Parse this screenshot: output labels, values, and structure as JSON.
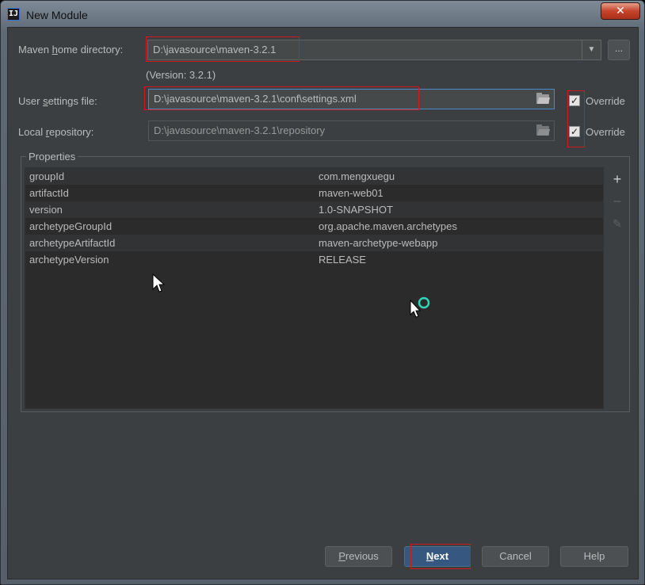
{
  "window": {
    "title": "New Module",
    "app_icon_text": "IJ",
    "close_glyph": "✕"
  },
  "maven": {
    "home_label_pre": "Maven ",
    "home_label_u": "h",
    "home_label_post": "ome directory:",
    "home_value": "D:\\javasource\\maven-3.2.1",
    "version_text": "(Version: 3.2.1)",
    "settings_label_pre": "User ",
    "settings_label_u": "s",
    "settings_label_post": "ettings file:",
    "settings_value": "D:\\javasource\\maven-3.2.1\\conf\\settings.xml",
    "repo_label_pre": "Local ",
    "repo_label_u": "r",
    "repo_label_post": "epository:",
    "repo_value": "D:\\javasource\\maven-3.2.1\\repository",
    "override_label": "Override",
    "override_settings_checked": true,
    "override_repo_checked": true,
    "browse_label": "..."
  },
  "properties": {
    "title": "Properties",
    "rows": [
      {
        "key": "groupId",
        "value": "com.mengxuegu"
      },
      {
        "key": "artifactId",
        "value": "maven-web01"
      },
      {
        "key": "version",
        "value": "1.0-SNAPSHOT"
      },
      {
        "key": "archetypeGroupId",
        "value": "org.apache.maven.archetypes"
      },
      {
        "key": "archetypeArtifactId",
        "value": "maven-archetype-webapp"
      },
      {
        "key": "archetypeVersion",
        "value": "RELEASE"
      }
    ],
    "tools": {
      "add": "+",
      "remove": "−",
      "edit": "✎"
    }
  },
  "buttons": {
    "previous_u": "P",
    "previous_rest": "revious",
    "next_u": "N",
    "next_rest": "ext",
    "cancel": "Cancel",
    "help": "Help"
  },
  "colors": {
    "accent": "#365880",
    "highlight_box": "#d21a1a",
    "panel": "#3c3f41",
    "table": "#2b2b2b"
  }
}
